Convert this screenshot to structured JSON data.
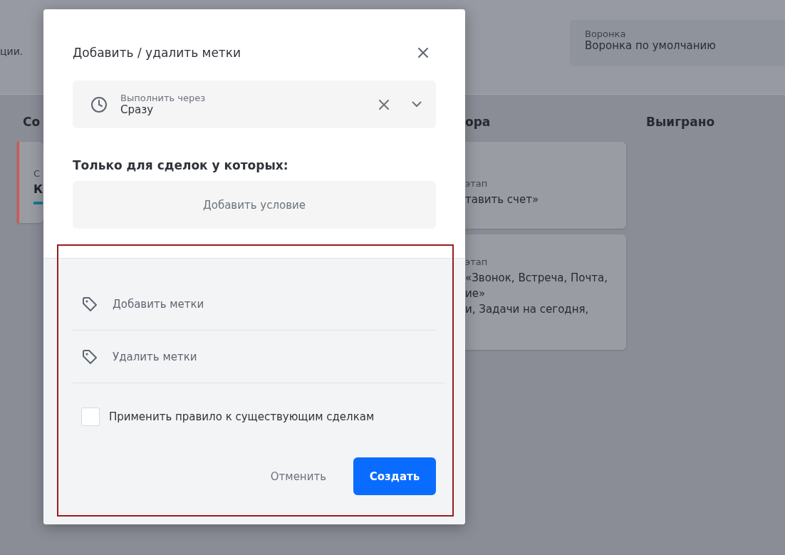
{
  "background": {
    "intro_text": "ции.",
    "funnel": {
      "label": "Воронка",
      "value": "Воронка по умолчанию"
    },
    "columns": [
      {
        "title": "Со",
        "cards": [
          {
            "lines": [
              "С",
              "К"
            ],
            "color": "#d9534f"
          }
        ]
      },
      {
        "title": "ора",
        "cards": [
          {
            "lines": [
              "этап",
              "тавить счет»"
            ]
          },
          {
            "lines": [
              "этап",
              "«Звонок, Встреча, Почта,",
              "ие»",
              "и, Задачи на сегодня,"
            ]
          }
        ]
      },
      {
        "title": "Выиграно"
      }
    ]
  },
  "modal": {
    "title": "Добавить / удалить метки",
    "delay": {
      "label": "Выполнить через",
      "value": "Сразу"
    },
    "condition_heading": "Только для сделок у которых:",
    "add_condition": "Добавить условие",
    "actions": [
      {
        "label": "Добавить метки"
      },
      {
        "label": "Удалить метки"
      }
    ],
    "apply_existing": {
      "label": "Применить правило к существующим сделкам",
      "checked": false
    },
    "buttons": {
      "cancel": "Отменить",
      "create": "Создать"
    },
    "highlighted": true
  }
}
